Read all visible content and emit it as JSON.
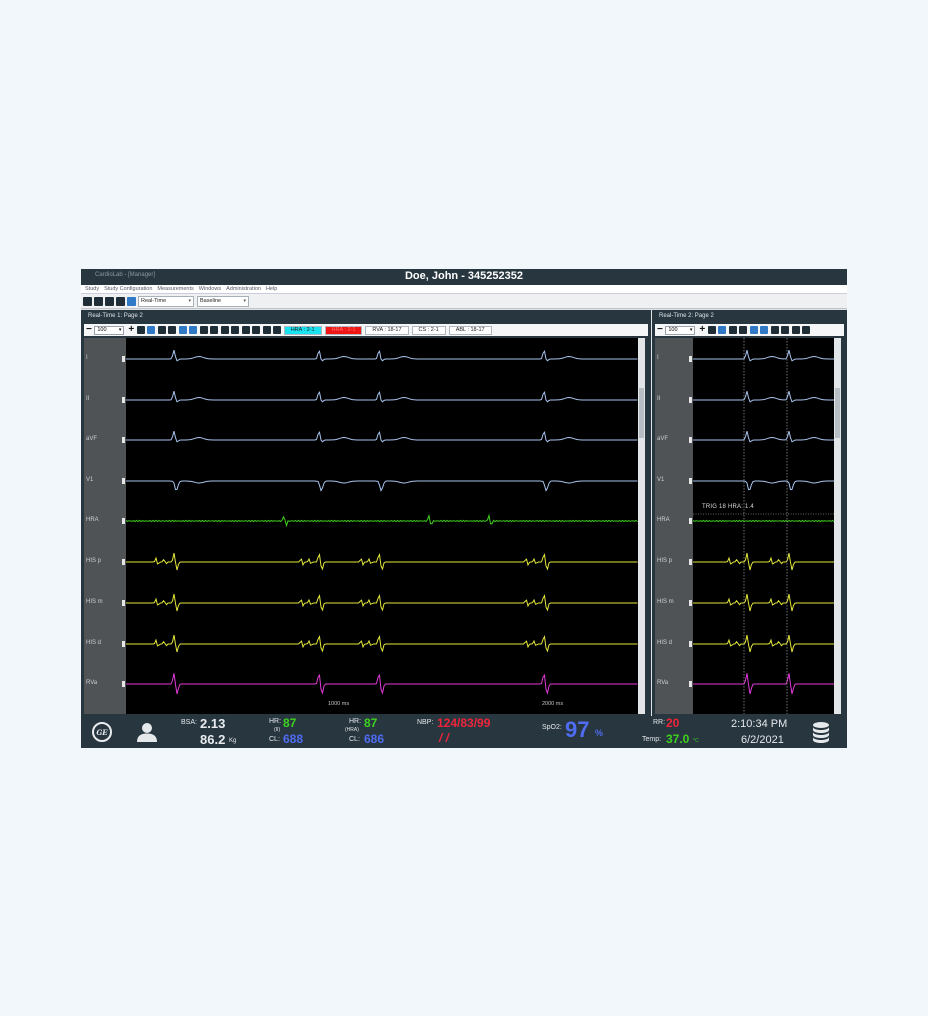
{
  "window": {
    "app_title": "CardioLab - [Manager]",
    "patient_title": "Doe, John - 345252352"
  },
  "menu": [
    "Study",
    "Study Configuration",
    "Measurements",
    "Windows",
    "Administration",
    "Help"
  ],
  "toolbar": {
    "mode_select": "Real-Time",
    "baseline_select": "Baseline"
  },
  "pane1": {
    "title": "Real-Time 1: Page 2",
    "zoom": "100",
    "tags": [
      {
        "label": "HRA : 2-1",
        "style": "cyan"
      },
      {
        "label": "HRA : 2-1",
        "style": "red"
      },
      {
        "label": "RVA : 18-17",
        "style": "plain"
      },
      {
        "label": "CS : 2-1",
        "style": "plain"
      },
      {
        "label": "ABL : 18-17",
        "style": "plain"
      }
    ],
    "time_labels": [
      "1000 ms",
      "2000 ms"
    ]
  },
  "pane2": {
    "title": "Real-Time 2: Page 2",
    "zoom": "100",
    "trigger_text": "TRIG 18 HRA: 1.4"
  },
  "leads": [
    "I",
    "II",
    "aVF",
    "V1",
    "HRA",
    "HIS p",
    "HIS m",
    "HIS d",
    "RVa"
  ],
  "colors": {
    "ecg": "#a9c4ef",
    "hra": "#3fd21e",
    "his": "#e4e83a",
    "rva": "#e23ad8",
    "hr_green": "#3fd21e",
    "cl_blue": "#4f6cf2",
    "nbp_red": "#f0243a",
    "spo2_blue": "#4f6cf2",
    "temp_green": "#3fd21e"
  },
  "status": {
    "bsa_label": "BSA:",
    "bsa_value": "2.13",
    "weight_value": "86.2",
    "weight_unit": "Kg",
    "hr1_label": "HR:",
    "hr1_sub": "(II)",
    "hr1_value": "87",
    "cl1_label": "CL:",
    "cl1_value": "688",
    "hr2_label": "HR:",
    "hr2_sub": "(HRA)",
    "hr2_value": "87",
    "cl2_label": "CL:",
    "cl2_value": "686",
    "nbp_label": "NBP:",
    "nbp_value": "124/83/99",
    "nbp_sub": "/ /",
    "spo2_label": "SpO2:",
    "spo2_value": "97",
    "spo2_unit": "%",
    "rr_label": "RR:",
    "rr_value": "20",
    "temp_label": "Temp:",
    "temp_value": "37.0",
    "temp_unit": "°C",
    "time": "2:10:34 PM",
    "date": "6/2/2021",
    "logo_text": "GE"
  }
}
